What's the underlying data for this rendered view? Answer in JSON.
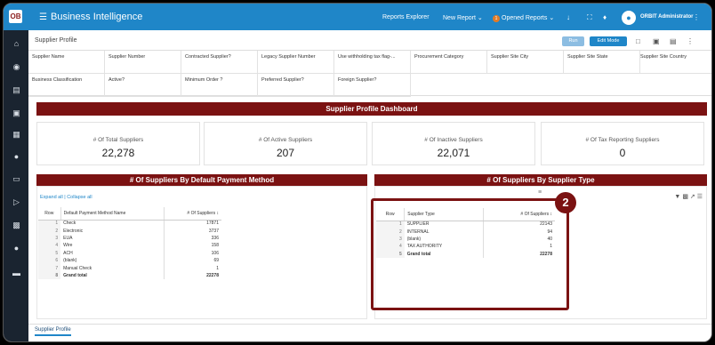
{
  "topbar": {
    "logo": "OB",
    "title": "Business Intelligence",
    "reports_explorer": "Reports Explorer",
    "new_report": "New Report",
    "opened_reports_count": "1",
    "opened_reports": "Opened Reports",
    "user_name": "ORBIT Administrator"
  },
  "page": {
    "breadcrumb": "Supplier Profile",
    "run_label": "Run",
    "edit_mode_label": "Edit Mode",
    "bottom_tab": "Supplier Profile"
  },
  "filters": [
    "Supplier Name",
    "Supplier Number",
    "Contracted Supplier?",
    "Legacy Supplier Number",
    "Use withholding tax flag-...",
    "Procurement Category",
    "Supplier Site City",
    "Supplier Site State",
    "Supplier Site Country",
    "Business Classification",
    "Active?",
    "Minimum Order ?",
    "Preferred Supplier?",
    "Foreign Supplier?"
  ],
  "dashboard": {
    "title": "Supplier Profile Dashboard",
    "kpis": [
      {
        "label": "# Of Total Suppliers",
        "value": "22,278"
      },
      {
        "label": "# Of Active Suppliers",
        "value": "207"
      },
      {
        "label": "# Of Inactive Suppliers",
        "value": "22,071"
      },
      {
        "label": "# Of Tax Reporting Suppliers",
        "value": "0"
      }
    ]
  },
  "payment_panel": {
    "title": "# Of Suppliers By Default Payment Method",
    "expand_all": "Expand all",
    "collapse_all": "Collapse all",
    "col_row": "Row",
    "col_name": "Default Payment Method Name",
    "col_count": "# Of Suppliers",
    "rows": [
      {
        "n": "1",
        "name": "Check",
        "count": "17871"
      },
      {
        "n": "2",
        "name": "Electronic",
        "count": "3737"
      },
      {
        "n": "3",
        "name": "EUA",
        "count": "336"
      },
      {
        "n": "4",
        "name": "Wire",
        "count": "158"
      },
      {
        "n": "5",
        "name": "ACH",
        "count": "106"
      },
      {
        "n": "6",
        "name": "(blank)",
        "count": "69"
      },
      {
        "n": "7",
        "name": "Manual Check",
        "count": "1"
      },
      {
        "n": "8",
        "name": "Grand total",
        "count": "22278"
      }
    ]
  },
  "type_panel": {
    "title": "# Of Suppliers By Supplier Type",
    "col_row": "Row",
    "col_name": "Supplier Type",
    "col_count": "# Of Suppliers",
    "rows": [
      {
        "n": "1",
        "name": "SUPPLIER",
        "count": "22143"
      },
      {
        "n": "2",
        "name": "INTERNAL",
        "count": "94"
      },
      {
        "n": "3",
        "name": "(blank)",
        "count": "40"
      },
      {
        "n": "4",
        "name": "TAX AUTHORITY",
        "count": "1"
      },
      {
        "n": "5",
        "name": "Grand total",
        "count": "22278"
      }
    ]
  },
  "step_marker": "2",
  "colors": {
    "brand_blue": "#1f86c8",
    "maroon": "#7b1212",
    "sidebar": "#1a2430"
  }
}
